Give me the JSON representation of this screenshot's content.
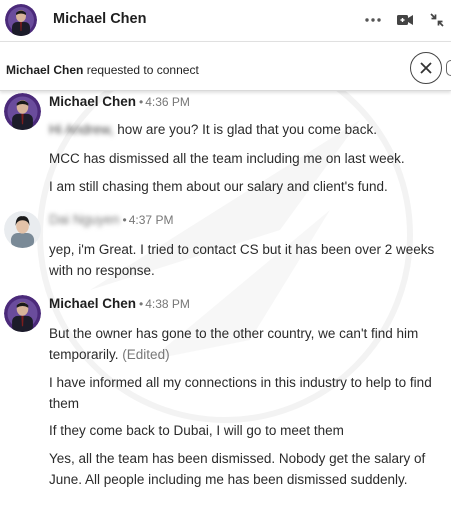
{
  "colors": {
    "accent_purple": "#4b2a7a",
    "text": "#1f1f1f",
    "muted": "#777777"
  },
  "header": {
    "contact_name": "Michael Chen",
    "icons": [
      "more-options-icon",
      "video-call-icon",
      "collapse-icon"
    ]
  },
  "notice": {
    "sender": "Michael Chen",
    "text": "requested to connect",
    "icons": [
      "close-icon"
    ]
  },
  "messages": [
    {
      "sender": "Michael Chen",
      "time": "4:36 PM",
      "lines": [
        {
          "blurred_prefix": "Hi Andrew,",
          "text": " how are you? It is glad that you come back."
        },
        {
          "text": "MCC has dismissed all the team including me on last week."
        },
        {
          "text": "I am still chasing them about our salary and client's fund."
        }
      ]
    },
    {
      "sender": "Dai Nguyen",
      "time": "4:37 PM",
      "lines": [
        {
          "text": "yep, i'm Great. I tried to contact CS but it has been over 2 weeks with no response."
        }
      ]
    },
    {
      "sender": "Michael Chen",
      "time": "4:38 PM",
      "lines": [
        {
          "text": "But the owner has gone to the other country, we can't find him temporarily.",
          "edited": "(Edited)"
        },
        {
          "text": "I have informed all my connections in this industry to help to find them"
        },
        {
          "text": "If they come back to Dubai, I will go to meet them"
        },
        {
          "text": "Yes, all the team has been dismissed. Nobody get the salary of June. All people including me has been dismissed suddenly."
        }
      ]
    }
  ]
}
